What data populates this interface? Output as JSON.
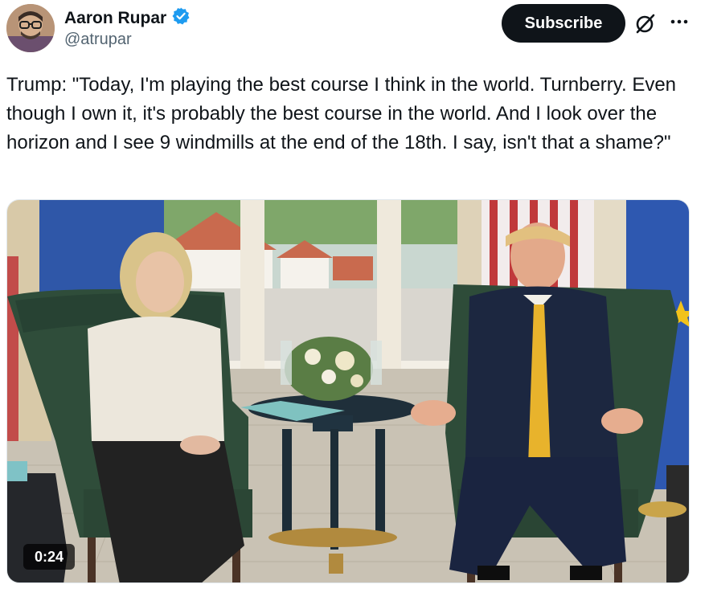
{
  "author": {
    "display_name": "Aaron Rupar",
    "handle": "@atrupar",
    "verified": true,
    "verified_color": "#1d9bf0"
  },
  "actions": {
    "subscribe_label": "Subscribe",
    "grok_icon": "grok-slash-circle-icon",
    "more_icon": "more-dots-icon"
  },
  "tweet": {
    "text": "Trump: \"Today, I'm playing the best course I think in the world. Turnberry. Even though I own it, it's probably the best course in the world. And I look over the horizon and I see 9 windmills at the end of the 18th. I say, isn't that a shame?\""
  },
  "media": {
    "type": "video",
    "duration": "0:24"
  },
  "colors": {
    "text_primary": "#0f1419",
    "text_secondary": "#536471",
    "button_dark": "#0f1419"
  }
}
